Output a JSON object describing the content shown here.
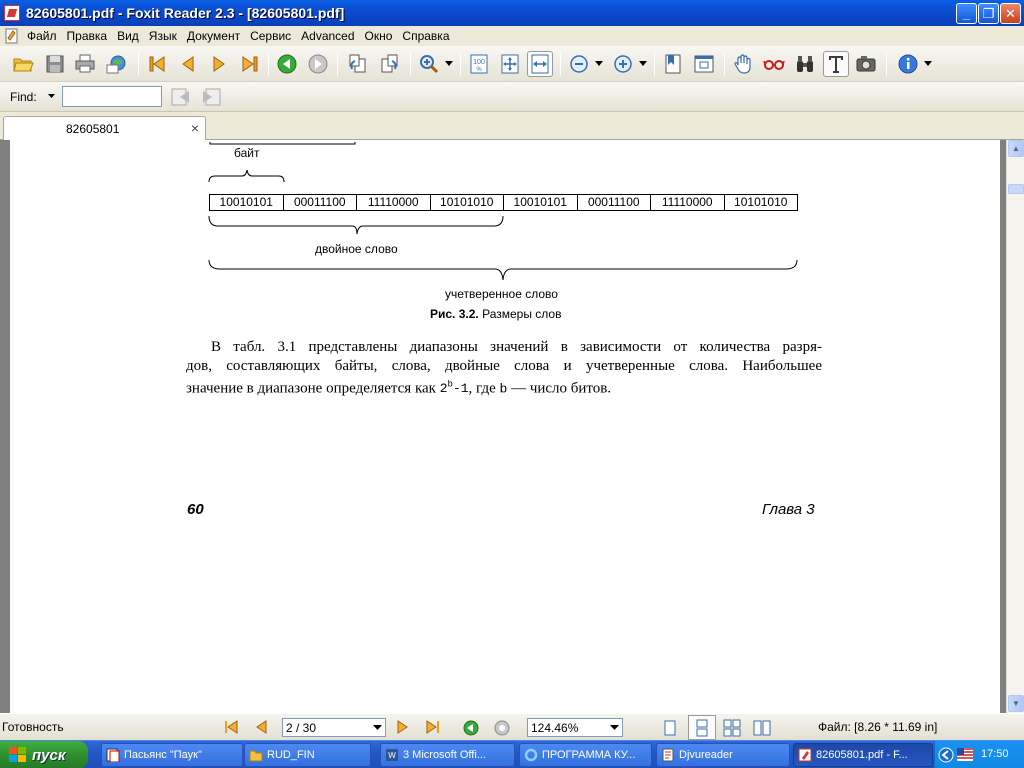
{
  "window": {
    "title": "82605801.pdf - Foxit Reader 2.3 - [82605801.pdf]",
    "min_label": "_",
    "max_label": "❐",
    "close_label": "✕"
  },
  "menu": [
    "Файл",
    "Правка",
    "Вид",
    "Язык",
    "Документ",
    "Сервис",
    "Advanced",
    "Окно",
    "Справка"
  ],
  "find": {
    "label": "Find:",
    "value": ""
  },
  "tab": {
    "label": "82605801",
    "close": "×"
  },
  "document": {
    "byte_label": "байт",
    "cells": [
      "10010101",
      "00011100",
      "11110000",
      "10101010",
      "10010101",
      "00011100",
      "11110000",
      "10101010"
    ],
    "dword_label": "двойное слово",
    "qword_label": "учетверенное слово",
    "caption_bold": "Рис. 3.2.",
    "caption_text": "Размеры слов",
    "para_line1": "В табл. 3.1 представлены диапазоны значений в зависимости от количества разря-",
    "para_line2": "дов, составляющих байты, слова, двойные слова и учетверенные слова. Наибольшее",
    "para_line3_a": "значение в диапазоне определяется как ",
    "para_line3_code_base": "2",
    "para_line3_code_sup": "b",
    "para_line3_code_rest": "-1",
    "para_line3_b": ", где ",
    "para_line3_code_b": "b",
    "para_line3_c": " — число битов.",
    "page_number": "60",
    "chapter": "Глава 3"
  },
  "status": {
    "ready": "Готовность",
    "page_field": "2 / 30",
    "zoom_field": "124.46%",
    "file_size": "Файл: [8.26 * 11.69 in]"
  },
  "taskbar": {
    "start": "пуск",
    "items": [
      {
        "label": "Пасьянс \"Паук\""
      },
      {
        "label": "RUD_FIN"
      },
      {
        "label": "3 Microsoft Offi..."
      },
      {
        "label": "ПРОГРАММА КУ..."
      },
      {
        "label": "Djvureader"
      },
      {
        "label": "82605801.pdf - F..."
      }
    ],
    "clock": "17:50"
  },
  "colors": {
    "title_bar": "#0a5fe4",
    "taskbar": "#2456c6",
    "start": "#2d8a2d"
  }
}
